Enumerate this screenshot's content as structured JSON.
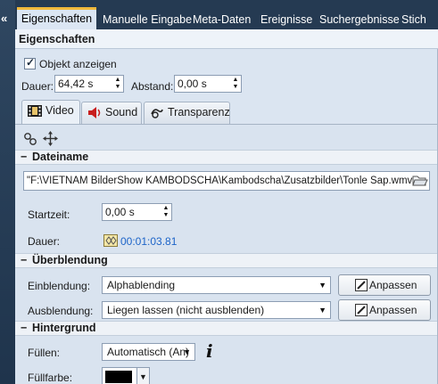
{
  "top_tabs": [
    {
      "label": "Eigenschaften"
    },
    {
      "label": "Manuelle Eingabe"
    },
    {
      "label": "Meta-Daten"
    },
    {
      "label": "Ereignisse"
    },
    {
      "label": "Suchergebnisse"
    },
    {
      "label": "Stich"
    }
  ],
  "collapse_arrow": "«",
  "panel_title": "Eigenschaften",
  "show_object": {
    "label": "Objekt anzeigen",
    "checked": true
  },
  "duration": {
    "label": "Dauer:",
    "value": "64,42 s"
  },
  "spacing": {
    "label": "Abstand:",
    "value": "0,00 s"
  },
  "sub_tabs": [
    {
      "label": "Video",
      "icon": "film-icon"
    },
    {
      "label": "Sound",
      "icon": "speaker-icon"
    },
    {
      "label": "Transparenz",
      "icon": "transparency-icon"
    }
  ],
  "sections": {
    "filename": {
      "title": "Dateiname",
      "collapse": "−"
    },
    "transition": {
      "title": "Überblendung",
      "collapse": "−"
    },
    "background": {
      "title": "Hintergrund",
      "collapse": "−"
    }
  },
  "file_path": "\"F:\\VIETNAM  BilderShow  KAMBODSCHA\\Kambodscha\\Zusatzbilder\\Tonle Sap.wmv\"",
  "start_time": {
    "label": "Startzeit:",
    "value": "0,00 s"
  },
  "duration_info": {
    "label": "Dauer:",
    "value": "00:01:03.81"
  },
  "fade_in": {
    "label": "Einblendung:",
    "value": "Alphablending",
    "button": "Anpassen"
  },
  "fade_out": {
    "label": "Ausblendung:",
    "value": "Liegen lassen (nicht ausblenden)",
    "button": "Anpassen"
  },
  "fill": {
    "label": "Füllen:",
    "value": "Automatisch (An)",
    "info": "i"
  },
  "fill_color": {
    "label": "Füllfarbe:",
    "color": "#000000"
  },
  "colors": {
    "tab_bar": "#253a52",
    "active_tab_accent": "#f0b93c",
    "link": "#1d64c8"
  }
}
